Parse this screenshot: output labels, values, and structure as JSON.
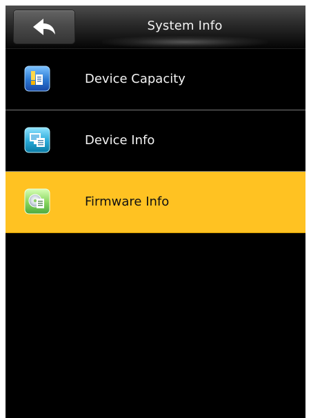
{
  "header": {
    "title": "System Info",
    "back_icon": "back-arrow-icon"
  },
  "menu": {
    "items": [
      {
        "label": "Device Capacity",
        "icon": "device-capacity-icon",
        "selected": false
      },
      {
        "label": "Device Info",
        "icon": "device-info-icon",
        "selected": false
      },
      {
        "label": "Firmware Info",
        "icon": "firmware-info-icon",
        "selected": true
      }
    ]
  },
  "colors": {
    "screen_background": "#000000",
    "header_background": "#2f2f2f",
    "selected_background": "#ffc222",
    "text_primary": "#f4f4f4",
    "text_selected": "#111111",
    "divider": "#7c7c7c"
  }
}
